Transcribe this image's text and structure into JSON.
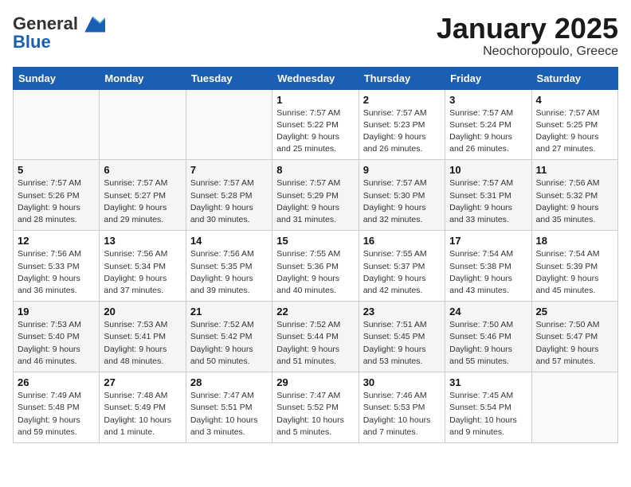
{
  "header": {
    "logo_general": "General",
    "logo_blue": "Blue",
    "month": "January 2025",
    "location": "Neochoropoulo, Greece"
  },
  "weekdays": [
    "Sunday",
    "Monday",
    "Tuesday",
    "Wednesday",
    "Thursday",
    "Friday",
    "Saturday"
  ],
  "weeks": [
    [
      null,
      null,
      null,
      {
        "day": "1",
        "sunrise": "Sunrise: 7:57 AM",
        "sunset": "Sunset: 5:22 PM",
        "daylight": "Daylight: 9 hours and 25 minutes."
      },
      {
        "day": "2",
        "sunrise": "Sunrise: 7:57 AM",
        "sunset": "Sunset: 5:23 PM",
        "daylight": "Daylight: 9 hours and 26 minutes."
      },
      {
        "day": "3",
        "sunrise": "Sunrise: 7:57 AM",
        "sunset": "Sunset: 5:24 PM",
        "daylight": "Daylight: 9 hours and 26 minutes."
      },
      {
        "day": "4",
        "sunrise": "Sunrise: 7:57 AM",
        "sunset": "Sunset: 5:25 PM",
        "daylight": "Daylight: 9 hours and 27 minutes."
      }
    ],
    [
      {
        "day": "5",
        "sunrise": "Sunrise: 7:57 AM",
        "sunset": "Sunset: 5:26 PM",
        "daylight": "Daylight: 9 hours and 28 minutes."
      },
      {
        "day": "6",
        "sunrise": "Sunrise: 7:57 AM",
        "sunset": "Sunset: 5:27 PM",
        "daylight": "Daylight: 9 hours and 29 minutes."
      },
      {
        "day": "7",
        "sunrise": "Sunrise: 7:57 AM",
        "sunset": "Sunset: 5:28 PM",
        "daylight": "Daylight: 9 hours and 30 minutes."
      },
      {
        "day": "8",
        "sunrise": "Sunrise: 7:57 AM",
        "sunset": "Sunset: 5:29 PM",
        "daylight": "Daylight: 9 hours and 31 minutes."
      },
      {
        "day": "9",
        "sunrise": "Sunrise: 7:57 AM",
        "sunset": "Sunset: 5:30 PM",
        "daylight": "Daylight: 9 hours and 32 minutes."
      },
      {
        "day": "10",
        "sunrise": "Sunrise: 7:57 AM",
        "sunset": "Sunset: 5:31 PM",
        "daylight": "Daylight: 9 hours and 33 minutes."
      },
      {
        "day": "11",
        "sunrise": "Sunrise: 7:56 AM",
        "sunset": "Sunset: 5:32 PM",
        "daylight": "Daylight: 9 hours and 35 minutes."
      }
    ],
    [
      {
        "day": "12",
        "sunrise": "Sunrise: 7:56 AM",
        "sunset": "Sunset: 5:33 PM",
        "daylight": "Daylight: 9 hours and 36 minutes."
      },
      {
        "day": "13",
        "sunrise": "Sunrise: 7:56 AM",
        "sunset": "Sunset: 5:34 PM",
        "daylight": "Daylight: 9 hours and 37 minutes."
      },
      {
        "day": "14",
        "sunrise": "Sunrise: 7:56 AM",
        "sunset": "Sunset: 5:35 PM",
        "daylight": "Daylight: 9 hours and 39 minutes."
      },
      {
        "day": "15",
        "sunrise": "Sunrise: 7:55 AM",
        "sunset": "Sunset: 5:36 PM",
        "daylight": "Daylight: 9 hours and 40 minutes."
      },
      {
        "day": "16",
        "sunrise": "Sunrise: 7:55 AM",
        "sunset": "Sunset: 5:37 PM",
        "daylight": "Daylight: 9 hours and 42 minutes."
      },
      {
        "day": "17",
        "sunrise": "Sunrise: 7:54 AM",
        "sunset": "Sunset: 5:38 PM",
        "daylight": "Daylight: 9 hours and 43 minutes."
      },
      {
        "day": "18",
        "sunrise": "Sunrise: 7:54 AM",
        "sunset": "Sunset: 5:39 PM",
        "daylight": "Daylight: 9 hours and 45 minutes."
      }
    ],
    [
      {
        "day": "19",
        "sunrise": "Sunrise: 7:53 AM",
        "sunset": "Sunset: 5:40 PM",
        "daylight": "Daylight: 9 hours and 46 minutes."
      },
      {
        "day": "20",
        "sunrise": "Sunrise: 7:53 AM",
        "sunset": "Sunset: 5:41 PM",
        "daylight": "Daylight: 9 hours and 48 minutes."
      },
      {
        "day": "21",
        "sunrise": "Sunrise: 7:52 AM",
        "sunset": "Sunset: 5:42 PM",
        "daylight": "Daylight: 9 hours and 50 minutes."
      },
      {
        "day": "22",
        "sunrise": "Sunrise: 7:52 AM",
        "sunset": "Sunset: 5:44 PM",
        "daylight": "Daylight: 9 hours and 51 minutes."
      },
      {
        "day": "23",
        "sunrise": "Sunrise: 7:51 AM",
        "sunset": "Sunset: 5:45 PM",
        "daylight": "Daylight: 9 hours and 53 minutes."
      },
      {
        "day": "24",
        "sunrise": "Sunrise: 7:50 AM",
        "sunset": "Sunset: 5:46 PM",
        "daylight": "Daylight: 9 hours and 55 minutes."
      },
      {
        "day": "25",
        "sunrise": "Sunrise: 7:50 AM",
        "sunset": "Sunset: 5:47 PM",
        "daylight": "Daylight: 9 hours and 57 minutes."
      }
    ],
    [
      {
        "day": "26",
        "sunrise": "Sunrise: 7:49 AM",
        "sunset": "Sunset: 5:48 PM",
        "daylight": "Daylight: 9 hours and 59 minutes."
      },
      {
        "day": "27",
        "sunrise": "Sunrise: 7:48 AM",
        "sunset": "Sunset: 5:49 PM",
        "daylight": "Daylight: 10 hours and 1 minute."
      },
      {
        "day": "28",
        "sunrise": "Sunrise: 7:47 AM",
        "sunset": "Sunset: 5:51 PM",
        "daylight": "Daylight: 10 hours and 3 minutes."
      },
      {
        "day": "29",
        "sunrise": "Sunrise: 7:47 AM",
        "sunset": "Sunset: 5:52 PM",
        "daylight": "Daylight: 10 hours and 5 minutes."
      },
      {
        "day": "30",
        "sunrise": "Sunrise: 7:46 AM",
        "sunset": "Sunset: 5:53 PM",
        "daylight": "Daylight: 10 hours and 7 minutes."
      },
      {
        "day": "31",
        "sunrise": "Sunrise: 7:45 AM",
        "sunset": "Sunset: 5:54 PM",
        "daylight": "Daylight: 10 hours and 9 minutes."
      },
      null
    ]
  ]
}
